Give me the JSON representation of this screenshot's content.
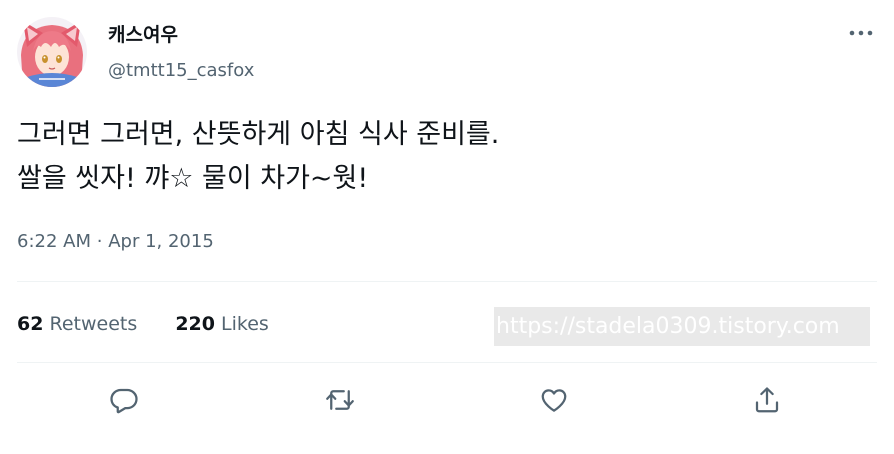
{
  "user": {
    "display_name": "캐스여우",
    "handle": "@tmtt15_casfox",
    "avatar_icon": "anime-avatar"
  },
  "tweet": {
    "lines": [
      "그러면 그러면, 산뜻하게 아침 식사 준비를.",
      "쌀을 씻자! 꺄☆ 물이 차가~웟!"
    ],
    "time": "6:22 AM",
    "separator": "·",
    "date": "Apr 1, 2015"
  },
  "stats": {
    "retweets_count": "62",
    "retweets_label": "Retweets",
    "likes_count": "220",
    "likes_label": "Likes"
  },
  "watermark": "https://stadela0309.tistory.com",
  "actions": [
    "reply-icon",
    "retweet-icon",
    "like-icon",
    "share-icon"
  ],
  "more_icon": "more-icon",
  "colors": {
    "text_primary": "#0f1419",
    "text_secondary": "#536471",
    "icon": "#536471",
    "divider": "#eff3f4"
  }
}
